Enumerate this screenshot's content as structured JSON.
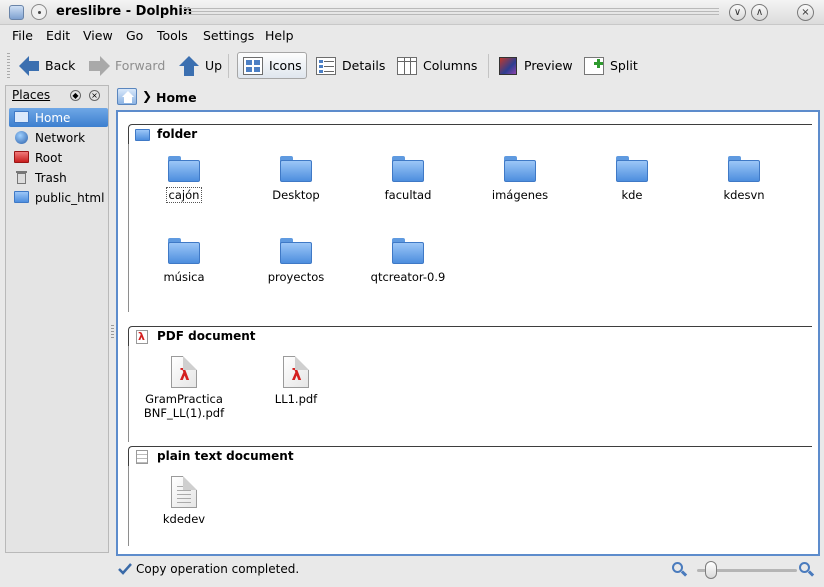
{
  "window": {
    "title": "ereslibre - Dolphin"
  },
  "menu": [
    "File",
    "Edit",
    "View",
    "Go",
    "Tools",
    "Settings",
    "Help"
  ],
  "toolbar": {
    "back": "Back",
    "forward": "Forward",
    "up": "Up",
    "icons": "Icons",
    "details": "Details",
    "columns": "Columns",
    "preview": "Preview",
    "split": "Split"
  },
  "places": {
    "title": "Places",
    "items": [
      "Home",
      "Network",
      "Root",
      "Trash",
      "public_html"
    ],
    "selected": "Home"
  },
  "breadcrumb": {
    "current": "Home"
  },
  "groups": [
    {
      "title": "folder",
      "items": [
        "cajón",
        "Desktop",
        "facultad",
        "imágenes",
        "kde",
        "kdesvn",
        "música",
        "proyectos",
        "qtcreator-0.9"
      ]
    },
    {
      "title": "PDF document",
      "items": [
        [
          "GramPractica",
          "BNF_LL(1).pdf"
        ],
        [
          "LL1.pdf"
        ]
      ]
    },
    {
      "title": "plain text document",
      "items": [
        "kdedev"
      ]
    }
  ],
  "status": {
    "message": "Copy operation completed.",
    "zoom_fraction": 0.1
  },
  "colors": {
    "selection": "#3c7fcf",
    "folder": "#4d8ede",
    "frame": "#5d8ccc"
  }
}
